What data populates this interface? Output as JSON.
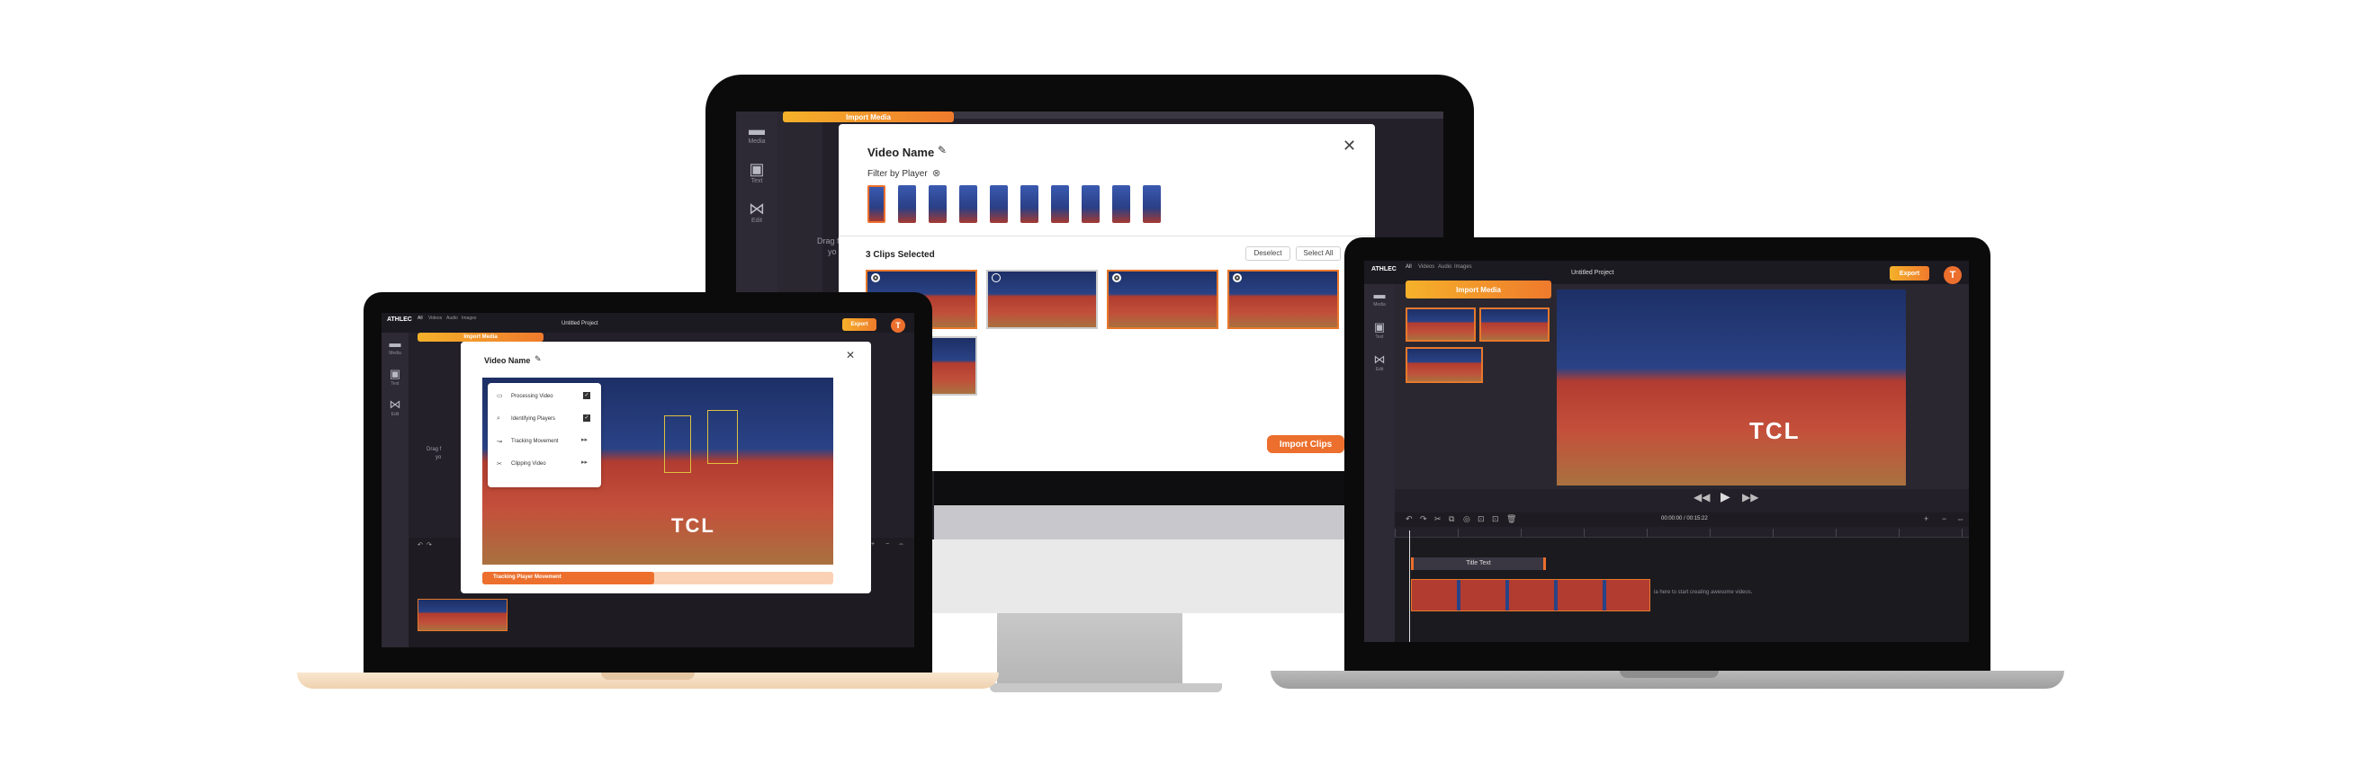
{
  "monitor": {
    "import_media_label": "Import Media",
    "sidebar": [
      {
        "label": "Media",
        "icon": "folder-icon"
      },
      {
        "label": "Text",
        "icon": "text-icon"
      },
      {
        "label": "Edit",
        "icon": "edit-icon"
      }
    ],
    "drag_text_line1": "Drag f",
    "drag_text_line2": "yo",
    "modal": {
      "title": "Video Name",
      "filter_label": "Filter by Player",
      "clips_selected": "3 Clips Selected",
      "deselect_label": "Deselect",
      "select_all_label": "Select All",
      "import_clips_label": "Import Clips"
    }
  },
  "laptop_left": {
    "logo": "ATHLEC",
    "tabs": [
      "All",
      "Videos",
      "Audio",
      "Images"
    ],
    "project_title": "Untitled Project",
    "export_label": "Export",
    "avatar_letter": "T",
    "import_media_label": "Import Media",
    "sidebar": [
      {
        "label": "Media"
      },
      {
        "label": "Text"
      },
      {
        "label": "Edit"
      }
    ],
    "drag_text_line1": "Drag f",
    "drag_text_line2": "yo",
    "modal": {
      "title": "Video Name",
      "steps": [
        {
          "label": "Processing Video",
          "status": "done"
        },
        {
          "label": "Identifying Players",
          "status": "done"
        },
        {
          "label": "Tracking Movement",
          "status": "pending"
        },
        {
          "label": "Clipping Video",
          "status": "pending"
        }
      ],
      "progress_label": "Tracking Player Movement",
      "progress_value": 0.49
    }
  },
  "laptop_right": {
    "logo": "ATHLEC",
    "tabs": [
      "All",
      "Videos",
      "Audio",
      "Images"
    ],
    "project_title": "Untitled Project",
    "export_label": "Export",
    "avatar_letter": "T",
    "import_media_label": "Import Media",
    "sidebar": [
      {
        "label": "Media"
      },
      {
        "label": "Text"
      },
      {
        "label": "Edit"
      }
    ],
    "timecode": "00:00:00 / 00:15:22",
    "title_text_clip": "Title Text",
    "timeline_hint": "ia here to start creating awesome videos."
  },
  "colors": {
    "accent": "#ec6f2d",
    "app_bg": "#232029",
    "sidebar_bg": "#2d2a35"
  }
}
